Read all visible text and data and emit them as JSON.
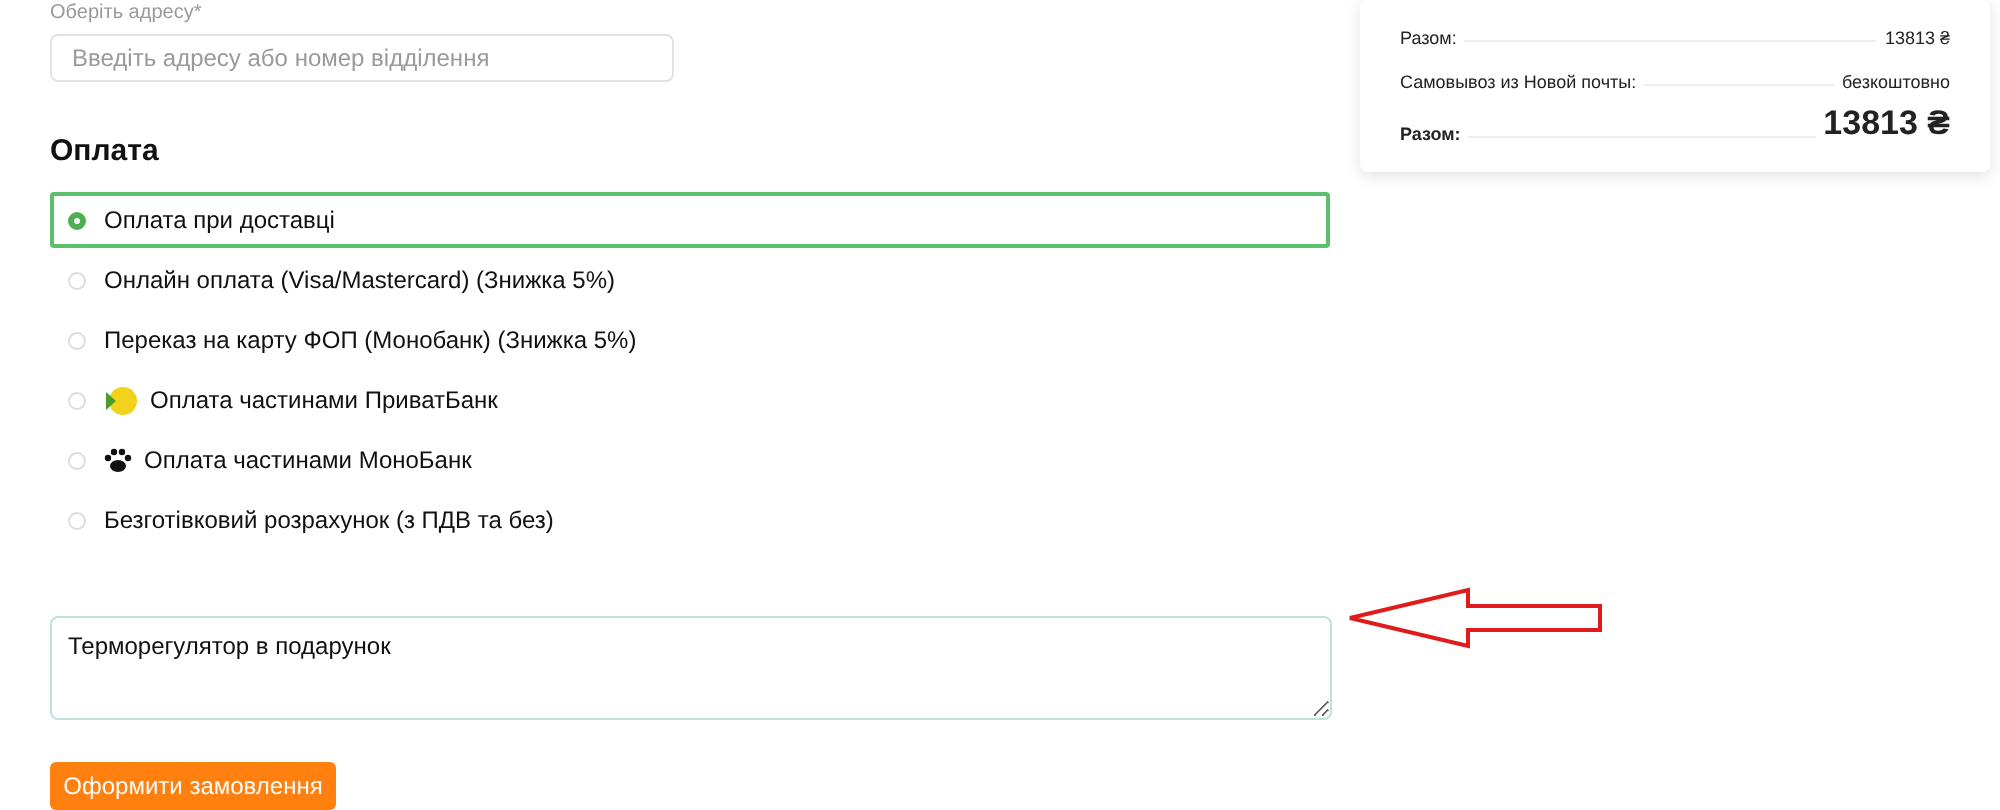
{
  "address": {
    "label": "Оберіть адресу*",
    "placeholder": "Введіть адресу або номер відділення"
  },
  "payment": {
    "title": "Оплата",
    "options": [
      {
        "label": "Оплата при доставці",
        "selected": true,
        "kind": "plain"
      },
      {
        "label": "Онлайн оплата (Visa/Mastercard) (Знижка 5%)",
        "selected": false,
        "kind": "plain"
      },
      {
        "label": "Переказ на карту ФОП (Монобанк) (Знижка 5%)",
        "selected": false,
        "kind": "plain"
      },
      {
        "label": "Оплата частинами ПриватБанк",
        "selected": false,
        "kind": "privat"
      },
      {
        "label": "Оплата частинами МоноБанк",
        "selected": false,
        "kind": "mono"
      },
      {
        "label": "Безготівковий розрахунок (з ПДВ та без)",
        "selected": false,
        "kind": "plain"
      }
    ]
  },
  "comment": {
    "value": "Терморегулятор в подарунок"
  },
  "submit": "Оформити замовлення",
  "summary": [
    {
      "label": "Разом:",
      "value": "13813 ₴",
      "kind": "normal"
    },
    {
      "label": "Самовывоз из Новой почты:",
      "value": "безкоштовно",
      "kind": "normal"
    },
    {
      "label": "Разом:",
      "value": "13813 ₴",
      "kind": "total"
    }
  ]
}
